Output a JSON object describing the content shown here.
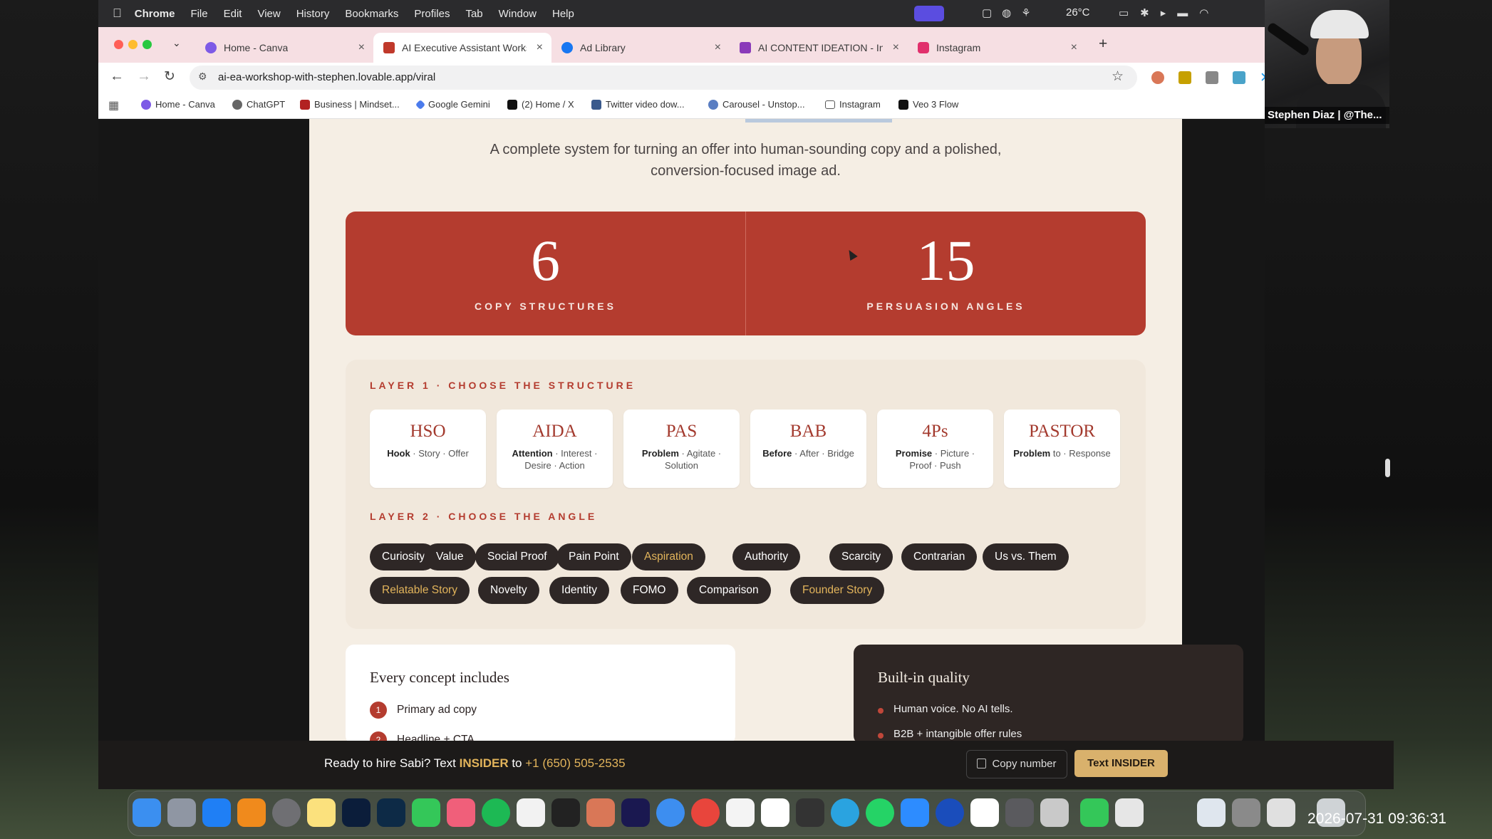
{
  "menubar": {
    "app": "Chrome",
    "items": [
      "File",
      "Edit",
      "View",
      "History",
      "Bookmarks",
      "Profiles",
      "Tab",
      "Window",
      "Help"
    ],
    "weather": "26°C"
  },
  "tabs": [
    {
      "title": "Home - Canva",
      "color": "#7d5ae6"
    },
    {
      "title": "AI Executive Assistant Works",
      "color": "#c0392b"
    },
    {
      "title": "Ad Library",
      "color": "#1877f2"
    },
    {
      "title": "AI CONTENT IDEATION - Inst",
      "color": "#8a3ab9"
    },
    {
      "title": "Instagram",
      "color": "#e1306c"
    }
  ],
  "address": {
    "url": "ai-ea-workshop-with-stephen.lovable.app/viral"
  },
  "bookmarks": [
    "Home - Canva",
    "ChatGPT",
    "Business | Mindset...",
    "Google Gemini",
    "(2) Home / X",
    "Twitter video dow...",
    "Carousel - Unstop...",
    "Instagram",
    "Veo 3 Flow"
  ],
  "page": {
    "subtitle_line1": "A complete system for turning an offer into human-sounding copy and a polished,",
    "subtitle_line2": "conversion-focused image ad.",
    "stats": [
      {
        "value": "6",
        "label": "COPY STRUCTURES"
      },
      {
        "value": "15",
        "label": "PERSUASION ANGLES"
      }
    ],
    "layer1_label": "LAYER 1 · CHOOSE THE STRUCTURE",
    "structures": [
      {
        "title": "HSO",
        "bold": "Hook",
        "rest": " · Story · Offer"
      },
      {
        "title": "AIDA",
        "bold": "Attention",
        "rest": " · Interest · Desire · Action"
      },
      {
        "title": "PAS",
        "bold": "Problem",
        "rest": " · Agitate · Solution"
      },
      {
        "title": "BAB",
        "bold": "Before",
        "rest": " · After · Bridge"
      },
      {
        "title": "4Ps",
        "bold": "Promise",
        "rest": " · Picture · Proof · Push"
      },
      {
        "title": "PASTOR",
        "bold": "Problem",
        "rest": " to · Response"
      }
    ],
    "layer2_label": "LAYER 2 · CHOOSE THE ANGLE",
    "angles_row1": [
      "Curiosity",
      "Value",
      "Social Proof",
      "Pain Point",
      "Aspiration",
      "Authority",
      "Scarcity",
      "Contrarian",
      "Us vs. Them"
    ],
    "angles_row2": [
      "Relatable Story",
      "Novelty",
      "Identity",
      "FOMO",
      "Comparison",
      "Founder Story"
    ],
    "highlighted_angles": [
      "Aspiration",
      "Relatable Story",
      "Founder Story"
    ],
    "concept_title": "Every concept includes",
    "concept_item1": "Primary ad copy",
    "concept_item2": "Headline + CTA",
    "quality_title": "Built-in quality",
    "quality_item1": "Human voice. No AI tells.",
    "quality_item2": "B2B + intangible offer rules"
  },
  "cta": {
    "prefix": "Ready to hire Sabi? Text ",
    "keyword": "INSIDER",
    "mid": " to ",
    "phone": "+1 (650) 505-2535",
    "copy_label": "Copy number",
    "text_label": "Text INSIDER"
  },
  "webcam": {
    "name": "Stephen Diaz | @The..."
  },
  "clock": "2026-07-31  09:36:31",
  "colors": {
    "brand_red": "#b43c2f",
    "gold": "#e2b45b",
    "pill_dark": "#2e2726",
    "page_bg": "#f5eee4"
  }
}
